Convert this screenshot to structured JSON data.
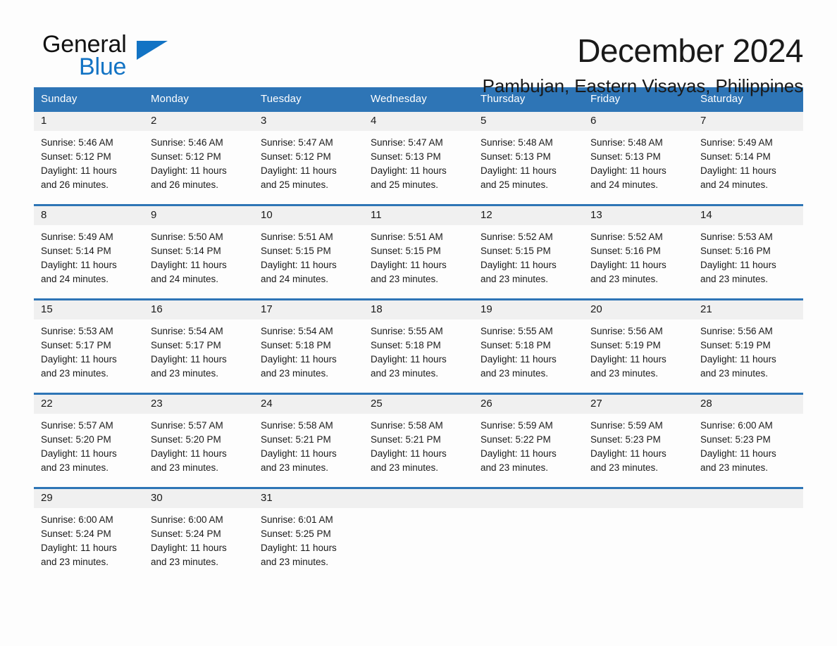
{
  "brand": {
    "name_part1": "General",
    "name_part2": "Blue",
    "accent_color": "#1273c4"
  },
  "header": {
    "month_title": "December 2024",
    "location": "Pambujan, Eastern Visayas, Philippines",
    "header_bar_color": "#2e75b6",
    "daynum_band_color": "#f0f0f0"
  },
  "weekday_headers": [
    "Sunday",
    "Monday",
    "Tuesday",
    "Wednesday",
    "Thursday",
    "Friday",
    "Saturday"
  ],
  "weeks": [
    [
      {
        "day": "1",
        "sunrise": "Sunrise: 5:46 AM",
        "sunset": "Sunset: 5:12 PM",
        "daylight_line1": "Daylight: 11 hours",
        "daylight_line2": "and 26 minutes."
      },
      {
        "day": "2",
        "sunrise": "Sunrise: 5:46 AM",
        "sunset": "Sunset: 5:12 PM",
        "daylight_line1": "Daylight: 11 hours",
        "daylight_line2": "and 26 minutes."
      },
      {
        "day": "3",
        "sunrise": "Sunrise: 5:47 AM",
        "sunset": "Sunset: 5:12 PM",
        "daylight_line1": "Daylight: 11 hours",
        "daylight_line2": "and 25 minutes."
      },
      {
        "day": "4",
        "sunrise": "Sunrise: 5:47 AM",
        "sunset": "Sunset: 5:13 PM",
        "daylight_line1": "Daylight: 11 hours",
        "daylight_line2": "and 25 minutes."
      },
      {
        "day": "5",
        "sunrise": "Sunrise: 5:48 AM",
        "sunset": "Sunset: 5:13 PM",
        "daylight_line1": "Daylight: 11 hours",
        "daylight_line2": "and 25 minutes."
      },
      {
        "day": "6",
        "sunrise": "Sunrise: 5:48 AM",
        "sunset": "Sunset: 5:13 PM",
        "daylight_line1": "Daylight: 11 hours",
        "daylight_line2": "and 24 minutes."
      },
      {
        "day": "7",
        "sunrise": "Sunrise: 5:49 AM",
        "sunset": "Sunset: 5:14 PM",
        "daylight_line1": "Daylight: 11 hours",
        "daylight_line2": "and 24 minutes."
      }
    ],
    [
      {
        "day": "8",
        "sunrise": "Sunrise: 5:49 AM",
        "sunset": "Sunset: 5:14 PM",
        "daylight_line1": "Daylight: 11 hours",
        "daylight_line2": "and 24 minutes."
      },
      {
        "day": "9",
        "sunrise": "Sunrise: 5:50 AM",
        "sunset": "Sunset: 5:14 PM",
        "daylight_line1": "Daylight: 11 hours",
        "daylight_line2": "and 24 minutes."
      },
      {
        "day": "10",
        "sunrise": "Sunrise: 5:51 AM",
        "sunset": "Sunset: 5:15 PM",
        "daylight_line1": "Daylight: 11 hours",
        "daylight_line2": "and 24 minutes."
      },
      {
        "day": "11",
        "sunrise": "Sunrise: 5:51 AM",
        "sunset": "Sunset: 5:15 PM",
        "daylight_line1": "Daylight: 11 hours",
        "daylight_line2": "and 23 minutes."
      },
      {
        "day": "12",
        "sunrise": "Sunrise: 5:52 AM",
        "sunset": "Sunset: 5:15 PM",
        "daylight_line1": "Daylight: 11 hours",
        "daylight_line2": "and 23 minutes."
      },
      {
        "day": "13",
        "sunrise": "Sunrise: 5:52 AM",
        "sunset": "Sunset: 5:16 PM",
        "daylight_line1": "Daylight: 11 hours",
        "daylight_line2": "and 23 minutes."
      },
      {
        "day": "14",
        "sunrise": "Sunrise: 5:53 AM",
        "sunset": "Sunset: 5:16 PM",
        "daylight_line1": "Daylight: 11 hours",
        "daylight_line2": "and 23 minutes."
      }
    ],
    [
      {
        "day": "15",
        "sunrise": "Sunrise: 5:53 AM",
        "sunset": "Sunset: 5:17 PM",
        "daylight_line1": "Daylight: 11 hours",
        "daylight_line2": "and 23 minutes."
      },
      {
        "day": "16",
        "sunrise": "Sunrise: 5:54 AM",
        "sunset": "Sunset: 5:17 PM",
        "daylight_line1": "Daylight: 11 hours",
        "daylight_line2": "and 23 minutes."
      },
      {
        "day": "17",
        "sunrise": "Sunrise: 5:54 AM",
        "sunset": "Sunset: 5:18 PM",
        "daylight_line1": "Daylight: 11 hours",
        "daylight_line2": "and 23 minutes."
      },
      {
        "day": "18",
        "sunrise": "Sunrise: 5:55 AM",
        "sunset": "Sunset: 5:18 PM",
        "daylight_line1": "Daylight: 11 hours",
        "daylight_line2": "and 23 minutes."
      },
      {
        "day": "19",
        "sunrise": "Sunrise: 5:55 AM",
        "sunset": "Sunset: 5:18 PM",
        "daylight_line1": "Daylight: 11 hours",
        "daylight_line2": "and 23 minutes."
      },
      {
        "day": "20",
        "sunrise": "Sunrise: 5:56 AM",
        "sunset": "Sunset: 5:19 PM",
        "daylight_line1": "Daylight: 11 hours",
        "daylight_line2": "and 23 minutes."
      },
      {
        "day": "21",
        "sunrise": "Sunrise: 5:56 AM",
        "sunset": "Sunset: 5:19 PM",
        "daylight_line1": "Daylight: 11 hours",
        "daylight_line2": "and 23 minutes."
      }
    ],
    [
      {
        "day": "22",
        "sunrise": "Sunrise: 5:57 AM",
        "sunset": "Sunset: 5:20 PM",
        "daylight_line1": "Daylight: 11 hours",
        "daylight_line2": "and 23 minutes."
      },
      {
        "day": "23",
        "sunrise": "Sunrise: 5:57 AM",
        "sunset": "Sunset: 5:20 PM",
        "daylight_line1": "Daylight: 11 hours",
        "daylight_line2": "and 23 minutes."
      },
      {
        "day": "24",
        "sunrise": "Sunrise: 5:58 AM",
        "sunset": "Sunset: 5:21 PM",
        "daylight_line1": "Daylight: 11 hours",
        "daylight_line2": "and 23 minutes."
      },
      {
        "day": "25",
        "sunrise": "Sunrise: 5:58 AM",
        "sunset": "Sunset: 5:21 PM",
        "daylight_line1": "Daylight: 11 hours",
        "daylight_line2": "and 23 minutes."
      },
      {
        "day": "26",
        "sunrise": "Sunrise: 5:59 AM",
        "sunset": "Sunset: 5:22 PM",
        "daylight_line1": "Daylight: 11 hours",
        "daylight_line2": "and 23 minutes."
      },
      {
        "day": "27",
        "sunrise": "Sunrise: 5:59 AM",
        "sunset": "Sunset: 5:23 PM",
        "daylight_line1": "Daylight: 11 hours",
        "daylight_line2": "and 23 minutes."
      },
      {
        "day": "28",
        "sunrise": "Sunrise: 6:00 AM",
        "sunset": "Sunset: 5:23 PM",
        "daylight_line1": "Daylight: 11 hours",
        "daylight_line2": "and 23 minutes."
      }
    ],
    [
      {
        "day": "29",
        "sunrise": "Sunrise: 6:00 AM",
        "sunset": "Sunset: 5:24 PM",
        "daylight_line1": "Daylight: 11 hours",
        "daylight_line2": "and 23 minutes."
      },
      {
        "day": "30",
        "sunrise": "Sunrise: 6:00 AM",
        "sunset": "Sunset: 5:24 PM",
        "daylight_line1": "Daylight: 11 hours",
        "daylight_line2": "and 23 minutes."
      },
      {
        "day": "31",
        "sunrise": "Sunrise: 6:01 AM",
        "sunset": "Sunset: 5:25 PM",
        "daylight_line1": "Daylight: 11 hours",
        "daylight_line2": "and 23 minutes."
      },
      {
        "day": "",
        "sunrise": "",
        "sunset": "",
        "daylight_line1": "",
        "daylight_line2": ""
      },
      {
        "day": "",
        "sunrise": "",
        "sunset": "",
        "daylight_line1": "",
        "daylight_line2": ""
      },
      {
        "day": "",
        "sunrise": "",
        "sunset": "",
        "daylight_line1": "",
        "daylight_line2": ""
      },
      {
        "day": "",
        "sunrise": "",
        "sunset": "",
        "daylight_line1": "",
        "daylight_line2": ""
      }
    ]
  ]
}
